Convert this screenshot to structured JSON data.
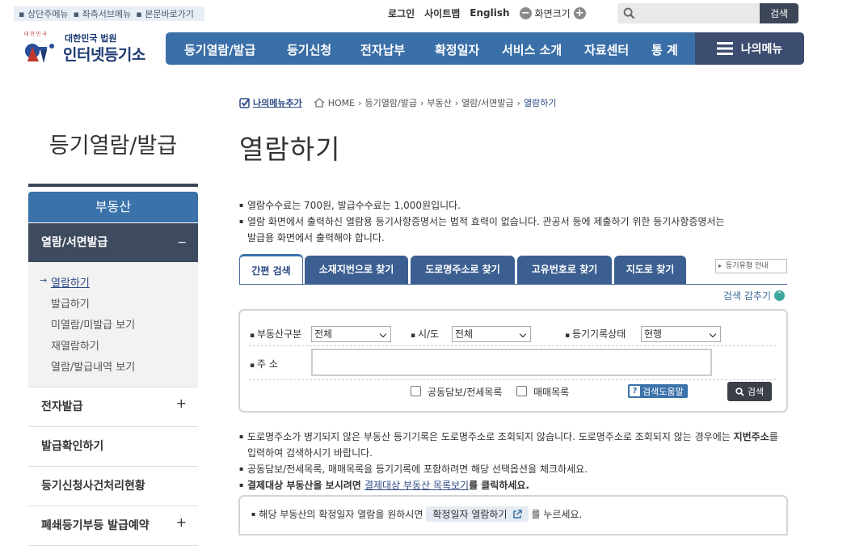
{
  "skip_links": [
    "상단주메뉴",
    "좌측서브메뉴",
    "본문바로가기"
  ],
  "util": {
    "login": "로그인",
    "sitemap": "사이트맵",
    "english": "English",
    "zoom": "화면크기",
    "zoom_minus": "−",
    "zoom_plus": "+",
    "search_button": "검색",
    "search_placeholder": ""
  },
  "logo": {
    "line1": "대한민국 법원",
    "line2": "인터넷등기소",
    "emblem_text": "대한민국법원"
  },
  "gnb": [
    "등기열람/발급",
    "등기신청",
    "전자납부",
    "확정일자",
    "서비스 소개",
    "자료센터",
    "통  계"
  ],
  "my_menu": "나의메뉴",
  "breadcrumb": {
    "add": "나의메뉴추가",
    "items": [
      "HOME",
      "등기열람/발급",
      "부동산",
      "열람/서면발급"
    ],
    "current": "열람하기"
  },
  "lnb": {
    "title": "등기열람/발급",
    "section": "부동산",
    "selected": "열람/서면발급",
    "selected_toggle": "−",
    "sub": [
      "열람하기",
      "발급하기",
      "미열람/미발급 보기",
      "재열람하기",
      "열람/발급내역 보기"
    ],
    "sub_marker": "→",
    "items": [
      {
        "label": "전자발급",
        "toggle": "+"
      },
      {
        "label": "발급확인하기",
        "toggle": ""
      },
      {
        "label": "등기신청사건처리현황",
        "toggle": ""
      },
      {
        "label": "폐쇄등기부등 발급예약",
        "toggle": "+"
      }
    ]
  },
  "page_title": "열람하기",
  "fee_notes": {
    "n1": "열람수수료는 700원, 발급수수료는 1,000원입니다.",
    "n2a": "열람 화면에서 출력하신 열람용 등기사항증명서는 법적 효력이 없습니다. 관공서 등에 제출하기 위한 등기사항증명서는",
    "n2b": "발급용 화면에서 출력해야 합니다."
  },
  "tabs": [
    "간편 검색",
    "소재지번으로 찾기",
    "도로명주소로 찾기",
    "고유번호로 찾기",
    "지도로 찾기"
  ],
  "guide_button": "등기유형 안내",
  "fold_toggle": "검색 감추기",
  "fold_icon": "⌃",
  "form": {
    "type_label": "부동산구분",
    "type_value": "전체",
    "city_label": "시/도",
    "city_value": "전체",
    "status_label": "등기기록상태",
    "status_value": "현행",
    "address_label": "주 소",
    "address_value": "",
    "chk1": "공동담보/전세목록",
    "chk2": "매매목록",
    "help_button": "검색도움말",
    "help_icon": "?",
    "search_button": "검색"
  },
  "bottom_notes": {
    "n1a": "도로명주소가 병기되지 않은 부동산 등기기록은 도로명주소로 조회되지 않습니다. 도로명주소로 조회되지 않는 경우에는 ",
    "n1b": "지번주소",
    "n1c": "를",
    "n1d": "입력하여 검색하시기 바랍니다.",
    "n2": "공동담보/전세목록, 매매목록을 등기기록에 포함하려면 해당 선택옵션을 체크하세요.",
    "n3a": "결제대상 부동산을 보시려면 ",
    "n3b": "결제대상 부동산 목록보기",
    "n3c": "를 클릭하세요."
  },
  "date_box": {
    "pre": "해당 부동산의 확정일자 열람을 원하시면",
    "button": "확정일자 열람하기",
    "post": "를 누르세요."
  },
  "colors": {
    "nav_blue": "#3a6fa8",
    "nav_dark": "#3d4d70",
    "lnb_dark": "#3e4a5d",
    "tab_blue": "#3c5f92"
  }
}
